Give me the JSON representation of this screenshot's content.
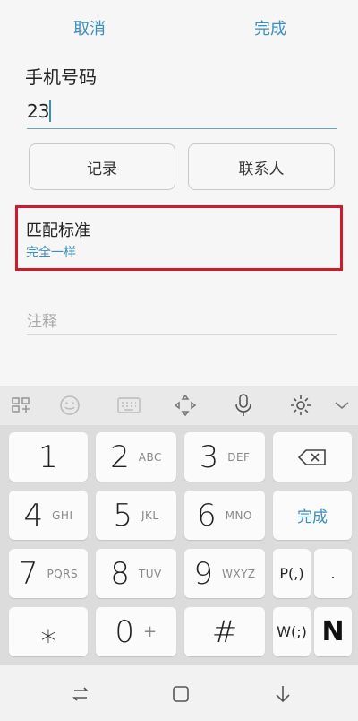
{
  "topbar": {
    "cancel_label": "取消",
    "done_label": "完成"
  },
  "phone": {
    "label": "手机号码",
    "value": "23"
  },
  "buttons": {
    "records_label": "记录",
    "contacts_label": "联系人"
  },
  "match": {
    "title": "匹配标准",
    "value": "完全一样"
  },
  "note": {
    "placeholder": "注释"
  },
  "keyboard": {
    "toolbar_icons": [
      "apps-icon",
      "emoji-icon",
      "keyboard-icon",
      "move-icon",
      "mic-icon",
      "gear-icon",
      "chevron-down-icon"
    ],
    "rows": [
      [
        {
          "main": "1",
          "sub": ""
        },
        {
          "main": "2",
          "sub": "ABC"
        },
        {
          "main": "3",
          "sub": "DEF"
        }
      ],
      [
        {
          "main": "4",
          "sub": "GHI"
        },
        {
          "main": "5",
          "sub": "JKL"
        },
        {
          "main": "6",
          "sub": "MNO"
        }
      ],
      [
        {
          "main": "7",
          "sub": "PQRS"
        },
        {
          "main": "8",
          "sub": "TUV"
        },
        {
          "main": "9",
          "sub": "WXYZ"
        }
      ],
      [
        {
          "main": "⁎",
          "sub": ""
        },
        {
          "main": "0",
          "sub": "+"
        },
        {
          "main": "#",
          "sub": ""
        }
      ]
    ],
    "side": {
      "done": "完成",
      "pause": "P(,)",
      "dot": ".",
      "wait": "W(;)",
      "n": "N"
    }
  },
  "colors": {
    "accent": "#3a8fbd",
    "highlight": "#d11a2a"
  }
}
